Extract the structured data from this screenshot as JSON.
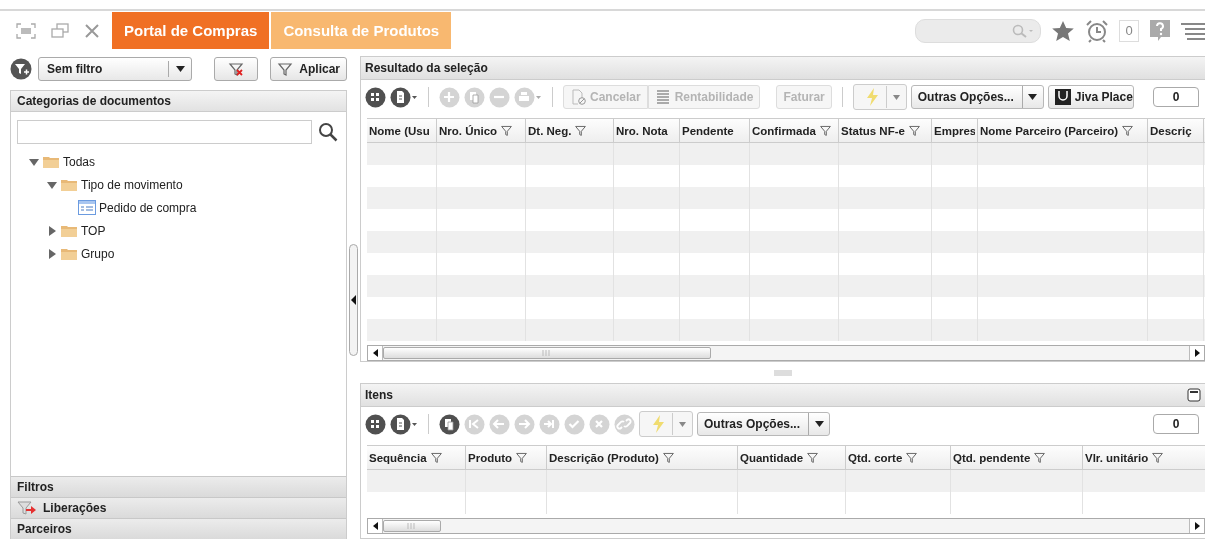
{
  "tabs": [
    {
      "label": "Portal de Compras",
      "selected": true
    },
    {
      "label": "Consulta de Produtos",
      "selected": false
    }
  ],
  "notification_count": "0",
  "filter_bar": {
    "selected_filter": "Sem filtro",
    "apply_label": "Aplicar"
  },
  "categories": {
    "title": "Categorias de documentos",
    "tree": [
      {
        "label": "Todas",
        "kind": "folder",
        "expanded": true,
        "children": [
          {
            "label": "Tipo de movimento",
            "kind": "folder",
            "expanded": true,
            "children": [
              {
                "label": "Pedido de compra",
                "kind": "form"
              }
            ]
          },
          {
            "label": "TOP",
            "kind": "folder",
            "expanded": false
          },
          {
            "label": "Grupo",
            "kind": "folder",
            "expanded": false
          }
        ]
      }
    ]
  },
  "sections": [
    {
      "label": "Filtros",
      "kind": "plain"
    },
    {
      "label": "Liberações",
      "kind": "release"
    },
    {
      "label": "Parceiros",
      "kind": "plain"
    }
  ],
  "result": {
    "title": "Resultado da seleção",
    "maximize_button": false,
    "toolbar": [
      {
        "kind": "grid",
        "disabled": false
      },
      {
        "kind": "document",
        "disabled": false
      },
      {
        "kind": "separator"
      },
      {
        "kind": "add",
        "disabled": true
      },
      {
        "kind": "copy",
        "disabled": true
      },
      {
        "kind": "remove",
        "disabled": true
      },
      {
        "kind": "print",
        "disabled": true
      },
      {
        "kind": "separator"
      },
      {
        "kind": "cancel",
        "label": "Cancelar",
        "disabled": true
      },
      {
        "kind": "report",
        "label": "Rentabilidade",
        "disabled": true
      },
      {
        "kind": "button",
        "label": "Faturar",
        "disabled": true
      },
      {
        "kind": "separator"
      },
      {
        "kind": "lightning",
        "disabled": true
      },
      {
        "kind": "dropdown",
        "label": "Outras Opções..."
      },
      {
        "kind": "store",
        "label": "Jiva Place"
      },
      {
        "kind": "counter",
        "label": "0"
      }
    ],
    "columns": [
      {
        "label": "Nome (Usu",
        "filterable": false
      },
      {
        "label": "Nro. Único",
        "filterable": true
      },
      {
        "label": "Dt. Neg.",
        "filterable": true
      },
      {
        "label": "Nro. Nota",
        "filterable": false
      },
      {
        "label": "Pendente",
        "filterable": false
      },
      {
        "label": "Confirmada",
        "filterable": true
      },
      {
        "label": "Status NF-e",
        "filterable": true
      },
      {
        "label": "Empres",
        "filterable": false
      },
      {
        "label": "Nome Parceiro (Parceiro)",
        "filterable": true
      },
      {
        "label": "Descriç",
        "filterable": false
      }
    ]
  },
  "items": {
    "title": "Itens",
    "maximize_button": true,
    "toolbar": [
      {
        "kind": "grid",
        "disabled": false
      },
      {
        "kind": "document",
        "disabled": false
      },
      {
        "kind": "separator"
      },
      {
        "kind": "copy",
        "disabled": false
      },
      {
        "kind": "first",
        "disabled": true
      },
      {
        "kind": "previous",
        "disabled": true
      },
      {
        "kind": "next",
        "disabled": true
      },
      {
        "kind": "last",
        "disabled": true
      },
      {
        "kind": "confirm",
        "disabled": true
      },
      {
        "kind": "discard",
        "disabled": true
      },
      {
        "kind": "link",
        "disabled": true
      },
      {
        "kind": "lightning",
        "disabled": true
      },
      {
        "kind": "dropdown",
        "label": "Outras Opções..."
      },
      {
        "kind": "counter",
        "label": "0"
      }
    ],
    "columns": [
      {
        "label": "Sequência",
        "filterable": true
      },
      {
        "label": "Produto",
        "filterable": true
      },
      {
        "label": "Descrição (Produto)",
        "filterable": true
      },
      {
        "label": "Quantidade",
        "filterable": true
      },
      {
        "label": "Qtd. corte",
        "filterable": true
      },
      {
        "label": "Qtd. pendente",
        "filterable": true
      },
      {
        "label": "Vlr. unitário",
        "filterable": true
      }
    ]
  }
}
